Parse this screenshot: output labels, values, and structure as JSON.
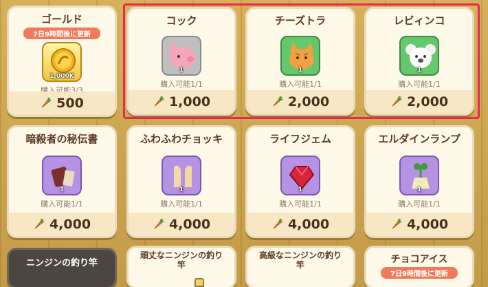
{
  "row1": [
    {
      "name": "ゴールド",
      "ribbon": "7日9時間後に更新",
      "icon": "gold-coin-icon",
      "qty": "1,000K",
      "limit": "購入可能3/3",
      "price": "500"
    },
    {
      "name": "コック",
      "icon": "pink-pig-icon",
      "qty": "1",
      "limit": "購入可能1/1",
      "price": "1,000"
    },
    {
      "name": "チーズトラ",
      "icon": "orange-cat-icon",
      "qty": "1",
      "limit": "購入可能1/1",
      "price": "2,000"
    },
    {
      "name": "レビィンコ",
      "icon": "white-koala-icon",
      "qty": "1",
      "limit": "購入可能1/1",
      "price": "2,000"
    }
  ],
  "row2": [
    {
      "name": "暗殺者の秘伝書",
      "icon": "scroll-book-icon",
      "qty": "1",
      "limit": "購入可能1/1",
      "price": "4,000"
    },
    {
      "name": "ふわふわチョッキ",
      "icon": "fluffy-vest-icon",
      "qty": "1",
      "limit": "購入可能1/1",
      "price": "4,000"
    },
    {
      "name": "ライフジェム",
      "icon": "red-gem-icon",
      "qty": "1",
      "limit": "購入可能1/1",
      "price": "4,000"
    },
    {
      "name": "エルダインランプ",
      "icon": "plant-lamp-icon",
      "qty": "1",
      "limit": "購入可能1/1",
      "price": "4,000"
    }
  ],
  "row3": [
    {
      "name": "ニンジンの釣り竿"
    },
    {
      "name": "頑丈なニンジンの釣り竿"
    },
    {
      "name": "高級なニンジンの釣り竿"
    },
    {
      "name": "チョコアイス",
      "ribbon": "7日9時間後に更新"
    }
  ],
  "colors": {
    "highlight": "#e8265a",
    "ribbon": "#f07a5c",
    "card": "#fff9ea"
  }
}
